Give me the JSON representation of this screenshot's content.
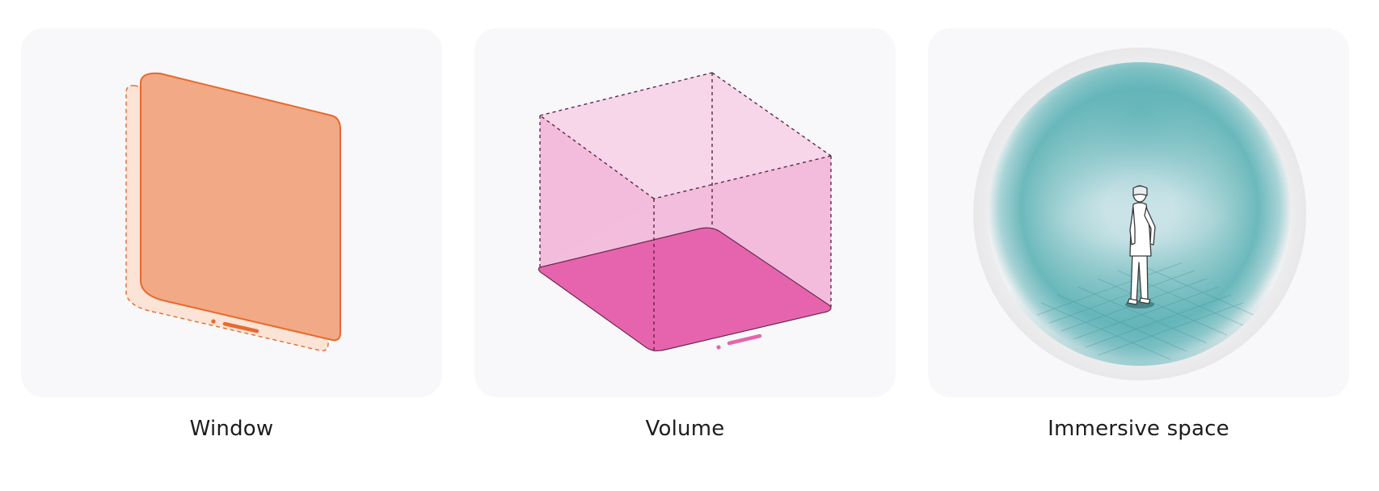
{
  "colors": {
    "background": "#ffffff",
    "panel": "#f8f8fa",
    "window_fill": "#f2a985",
    "window_stroke": "#e8692d",
    "volume_floor": "#e664ad",
    "volume_side": "#f3bbdc",
    "volume_top": "#f7d6ea",
    "immersive_teal": "#5fb3b7",
    "caption_text": "#1d1d1f"
  },
  "icons": {
    "window": "window-illustration-icon",
    "volume": "volume-illustration-icon",
    "immersive": "immersive-space-illustration-icon",
    "person": "person-with-headset-icon"
  },
  "items": [
    {
      "label": "Window"
    },
    {
      "label": "Volume"
    },
    {
      "label": "Immersive space"
    }
  ]
}
